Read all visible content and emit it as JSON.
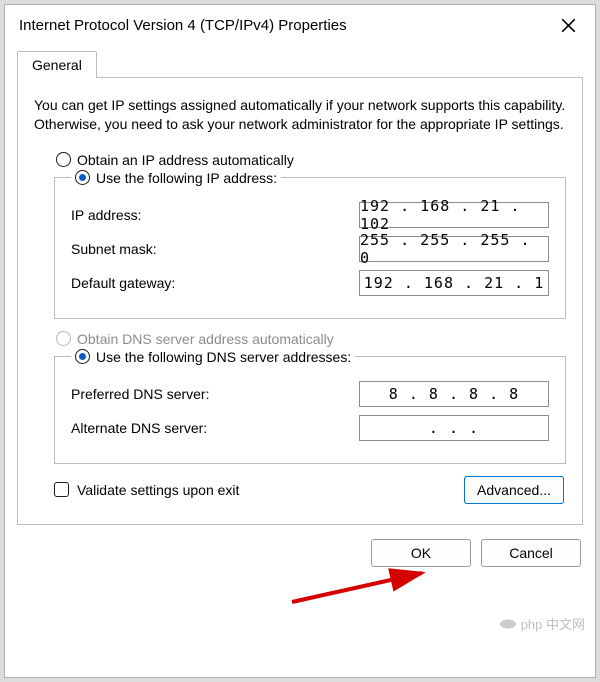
{
  "window": {
    "title": "Internet Protocol Version 4 (TCP/IPv4) Properties"
  },
  "tabs": {
    "general": "General"
  },
  "intro": "You can get IP settings assigned automatically if your network supports this capability. Otherwise, you need to ask your network administrator for the appropriate IP settings.",
  "ip": {
    "auto_label": "Obtain an IP address automatically",
    "manual_label": "Use the following IP address:",
    "ip_address_label": "IP address:",
    "ip_address_value": "192 . 168 .  21  . 102",
    "subnet_label": "Subnet mask:",
    "subnet_value": "255 . 255 . 255 .  0",
    "gateway_label": "Default gateway:",
    "gateway_value": "192 . 168 .  21  .  1"
  },
  "dns": {
    "auto_label": "Obtain DNS server address automatically",
    "manual_label": "Use the following DNS server addresses:",
    "preferred_label": "Preferred DNS server:",
    "preferred_value": "8  .  8  .  8  .  8",
    "alternate_label": "Alternate DNS server:",
    "alternate_value": ".        .        ."
  },
  "validate_label": "Validate settings upon exit",
  "buttons": {
    "advanced": "Advanced...",
    "ok": "OK",
    "cancel": "Cancel"
  },
  "watermark": "php 中文网"
}
